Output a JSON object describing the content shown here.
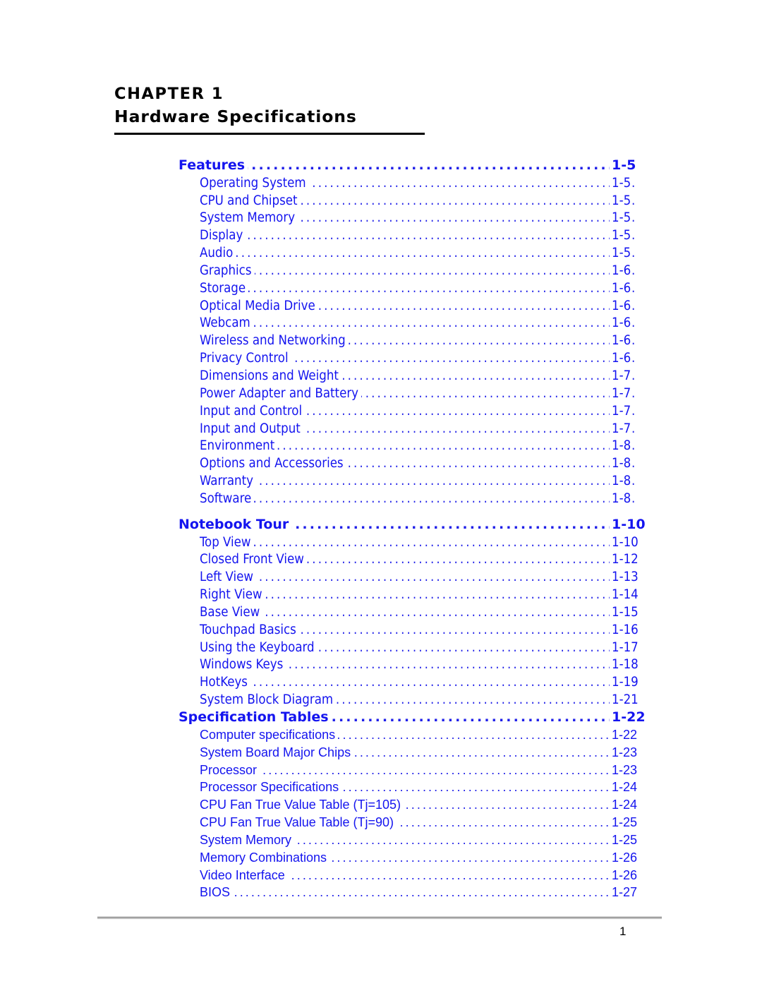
{
  "header": {
    "kicker": "CHAPTER 1",
    "title": "Hardware Specifications"
  },
  "colors": {
    "toc_link": "#1414ef",
    "rule": "#000000",
    "footer_rule": "#4d4d4d",
    "text": "#000000"
  },
  "toc": {
    "entries": [
      {
        "level": 1,
        "face": "condensed",
        "label": "Features",
        "page": "1-5"
      },
      {
        "level": 2,
        "face": "condensed",
        "label": "Operating System",
        "page": "1-5"
      },
      {
        "level": 2,
        "face": "condensed",
        "label": "CPU and Chipset",
        "page": "1-5"
      },
      {
        "level": 2,
        "face": "condensed",
        "label": "System Memory",
        "page": "1-5"
      },
      {
        "level": 2,
        "face": "condensed",
        "label": "Display",
        "page": "1-5"
      },
      {
        "level": 2,
        "face": "condensed",
        "label": "Audio",
        "page": "1-5"
      },
      {
        "level": 2,
        "face": "condensed",
        "label": "Graphics",
        "page": "1-6"
      },
      {
        "level": 2,
        "face": "condensed",
        "label": "Storage",
        "page": "1-6"
      },
      {
        "level": 2,
        "face": "condensed",
        "label": "Optical Media Drive",
        "page": "1-6"
      },
      {
        "level": 2,
        "face": "condensed",
        "label": "Webcam",
        "page": "1-6"
      },
      {
        "level": 2,
        "face": "condensed",
        "label": "Wireless and Networking",
        "page": "1-6"
      },
      {
        "level": 2,
        "face": "condensed",
        "label": "Privacy Control",
        "page": "1-6"
      },
      {
        "level": 2,
        "face": "condensed",
        "label": "Dimensions and Weight",
        "page": "1-7"
      },
      {
        "level": 2,
        "face": "condensed",
        "label": "Power Adapter and Battery",
        "page": "1-7"
      },
      {
        "level": 2,
        "face": "condensed",
        "label": "Input and Control",
        "page": "1-7"
      },
      {
        "level": 2,
        "face": "condensed",
        "label": "Input and Output",
        "page": "1-7"
      },
      {
        "level": 2,
        "face": "condensed",
        "label": "Environment",
        "page": "1-8"
      },
      {
        "level": 2,
        "face": "condensed",
        "label": "Options and Accessories",
        "page": "1-8"
      },
      {
        "level": 2,
        "face": "condensed",
        "label": "Warranty",
        "page": "1-8"
      },
      {
        "level": 2,
        "face": "condensed",
        "label": "Software",
        "page": "1-8"
      },
      {
        "level": 1,
        "face": "condensed",
        "label": "Notebook Tour",
        "page": "1-10",
        "gap_before": true
      },
      {
        "level": 2,
        "face": "condensed",
        "label": "Top View",
        "page": "1-10"
      },
      {
        "level": 2,
        "face": "condensed",
        "label": "Closed Front View",
        "page": "1-12"
      },
      {
        "level": 2,
        "face": "condensed",
        "label": "Left View",
        "page": "1-13"
      },
      {
        "level": 2,
        "face": "condensed",
        "label": "Right View",
        "page": "1-14"
      },
      {
        "level": 2,
        "face": "condensed",
        "label": "Base View",
        "page": "1-15"
      },
      {
        "level": 2,
        "face": "condensed",
        "label": "Touchpad Basics",
        "page": "1-16"
      },
      {
        "level": 2,
        "face": "condensed",
        "label": "Using the Keyboard",
        "page": "1-17"
      },
      {
        "level": 2,
        "face": "condensed",
        "label": "Windows Keys",
        "page": "1-18"
      },
      {
        "level": 2,
        "face": "condensed",
        "label": "HotKeys",
        "page": "1-19"
      },
      {
        "level": 2,
        "face": "condensed",
        "label": "System Block Diagram",
        "page": "1-21"
      },
      {
        "level": 1,
        "face": "condensed",
        "label": "Specification Tables",
        "page": "1-22"
      },
      {
        "level": 2,
        "face": "alt",
        "label": "Computer specifications",
        "page": "1-22"
      },
      {
        "level": 2,
        "face": "alt",
        "label": "System Board Major Chips",
        "page": "1-23"
      },
      {
        "level": 2,
        "face": "alt",
        "label": "Processor",
        "page": "1-23"
      },
      {
        "level": 2,
        "face": "alt",
        "label": "Processor Specifications",
        "page": "1-24"
      },
      {
        "level": 2,
        "face": "alt",
        "label": "CPU Fan True Value Table (Tj=105)",
        "page": "1-24"
      },
      {
        "level": 2,
        "face": "alt",
        "label": "CPU Fan True Value Table (Tj=90)",
        "page": "1-25"
      },
      {
        "level": 2,
        "face": "alt",
        "label": "System Memory",
        "page": "1-25"
      },
      {
        "level": 2,
        "face": "alt",
        "label": "Memory Combinations",
        "page": "1-26"
      },
      {
        "level": 2,
        "face": "alt",
        "label": "Video Interface",
        "page": "1-26"
      },
      {
        "level": 2,
        "face": "alt",
        "label": "BIOS",
        "page": "1-27"
      }
    ]
  },
  "footer": {
    "page_number": "1"
  }
}
